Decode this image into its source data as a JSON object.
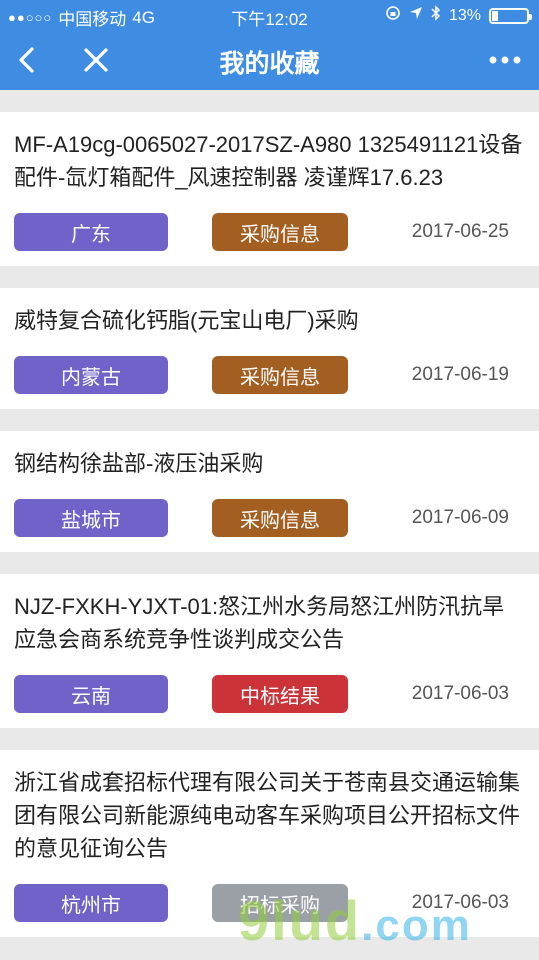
{
  "status_bar": {
    "carrier": "中国移动",
    "network": "4G",
    "time": "下午12:02",
    "battery": "13%"
  },
  "nav": {
    "title": "我的收藏"
  },
  "items": [
    {
      "title": "MF-A19cg-0065027-2017SZ-A980 1325491121设备配件-氙灯箱配件_风速控制器 凌谨辉17.6.23",
      "region": "广东",
      "type": "采购信息",
      "type_color": "#a35e21",
      "date": "2017-06-25"
    },
    {
      "title": "威特复合硫化钙脂(元宝山电厂)采购",
      "region": "内蒙古",
      "type": "采购信息",
      "type_color": "#a35e21",
      "date": "2017-06-19"
    },
    {
      "title": "钢结构徐盐部-液压油采购",
      "region": "盐城市",
      "type": "采购信息",
      "type_color": "#a35e21",
      "date": "2017-06-09"
    },
    {
      "title": "NJZ-FXKH-YJXT-01:怒江州水务局怒江州防汛抗旱应急会商系统竞争性谈判成交公告",
      "region": "云南",
      "type": "中标结果",
      "type_color": "#cc3339",
      "date": "2017-06-03"
    },
    {
      "title": "浙江省成套招标代理有限公司关于苍南县交通运输集团有限公司新能源纯电动客车采购项目公开招标文件的意见征询公告",
      "region": "杭州市",
      "type": "招标采购",
      "type_color": "#9aa0a6",
      "date": "2017-06-03"
    }
  ],
  "watermark": {
    "brand": "9lud",
    "tld": ".com"
  }
}
